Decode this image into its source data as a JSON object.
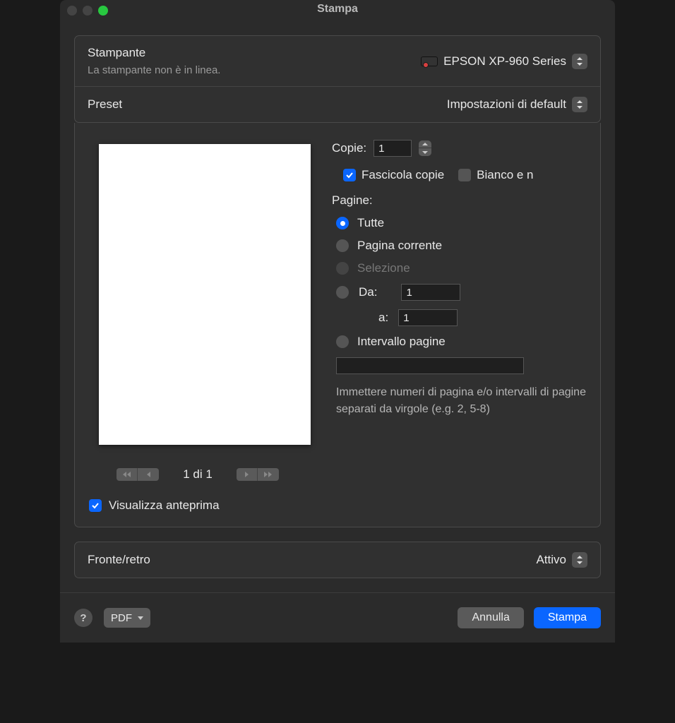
{
  "window": {
    "title": "Stampa"
  },
  "printer": {
    "label": "Stampante",
    "value": "EPSON XP-960 Series",
    "status": "La stampante non è in linea."
  },
  "preset": {
    "label": "Preset",
    "value": "Impostazioni di default"
  },
  "copies": {
    "label": "Copie:",
    "value": "1",
    "collate_label": "Fascicola copie",
    "collate_checked": true,
    "bw_label": "Bianco e n",
    "bw_checked": false
  },
  "pages": {
    "label": "Pagine:",
    "options": {
      "all": "Tutte",
      "current": "Pagina corrente",
      "selection": "Selezione",
      "from": "Da:",
      "to": "a:",
      "from_value": "1",
      "to_value": "1",
      "range": "Intervallo pagine",
      "range_value": ""
    },
    "selected": "all",
    "hint": "Immettere numeri di pagina e/o intervalli di pagine separati da virgole (e.g. 2, 5-8)"
  },
  "preview": {
    "page_counter": "1 di 1",
    "show_preview_label": "Visualizza anteprima",
    "show_preview_checked": true
  },
  "duplex": {
    "label": "Fronte/retro",
    "value": "Attivo"
  },
  "footer": {
    "pdf": "PDF",
    "cancel": "Annulla",
    "print": "Stampa",
    "help": "?"
  }
}
